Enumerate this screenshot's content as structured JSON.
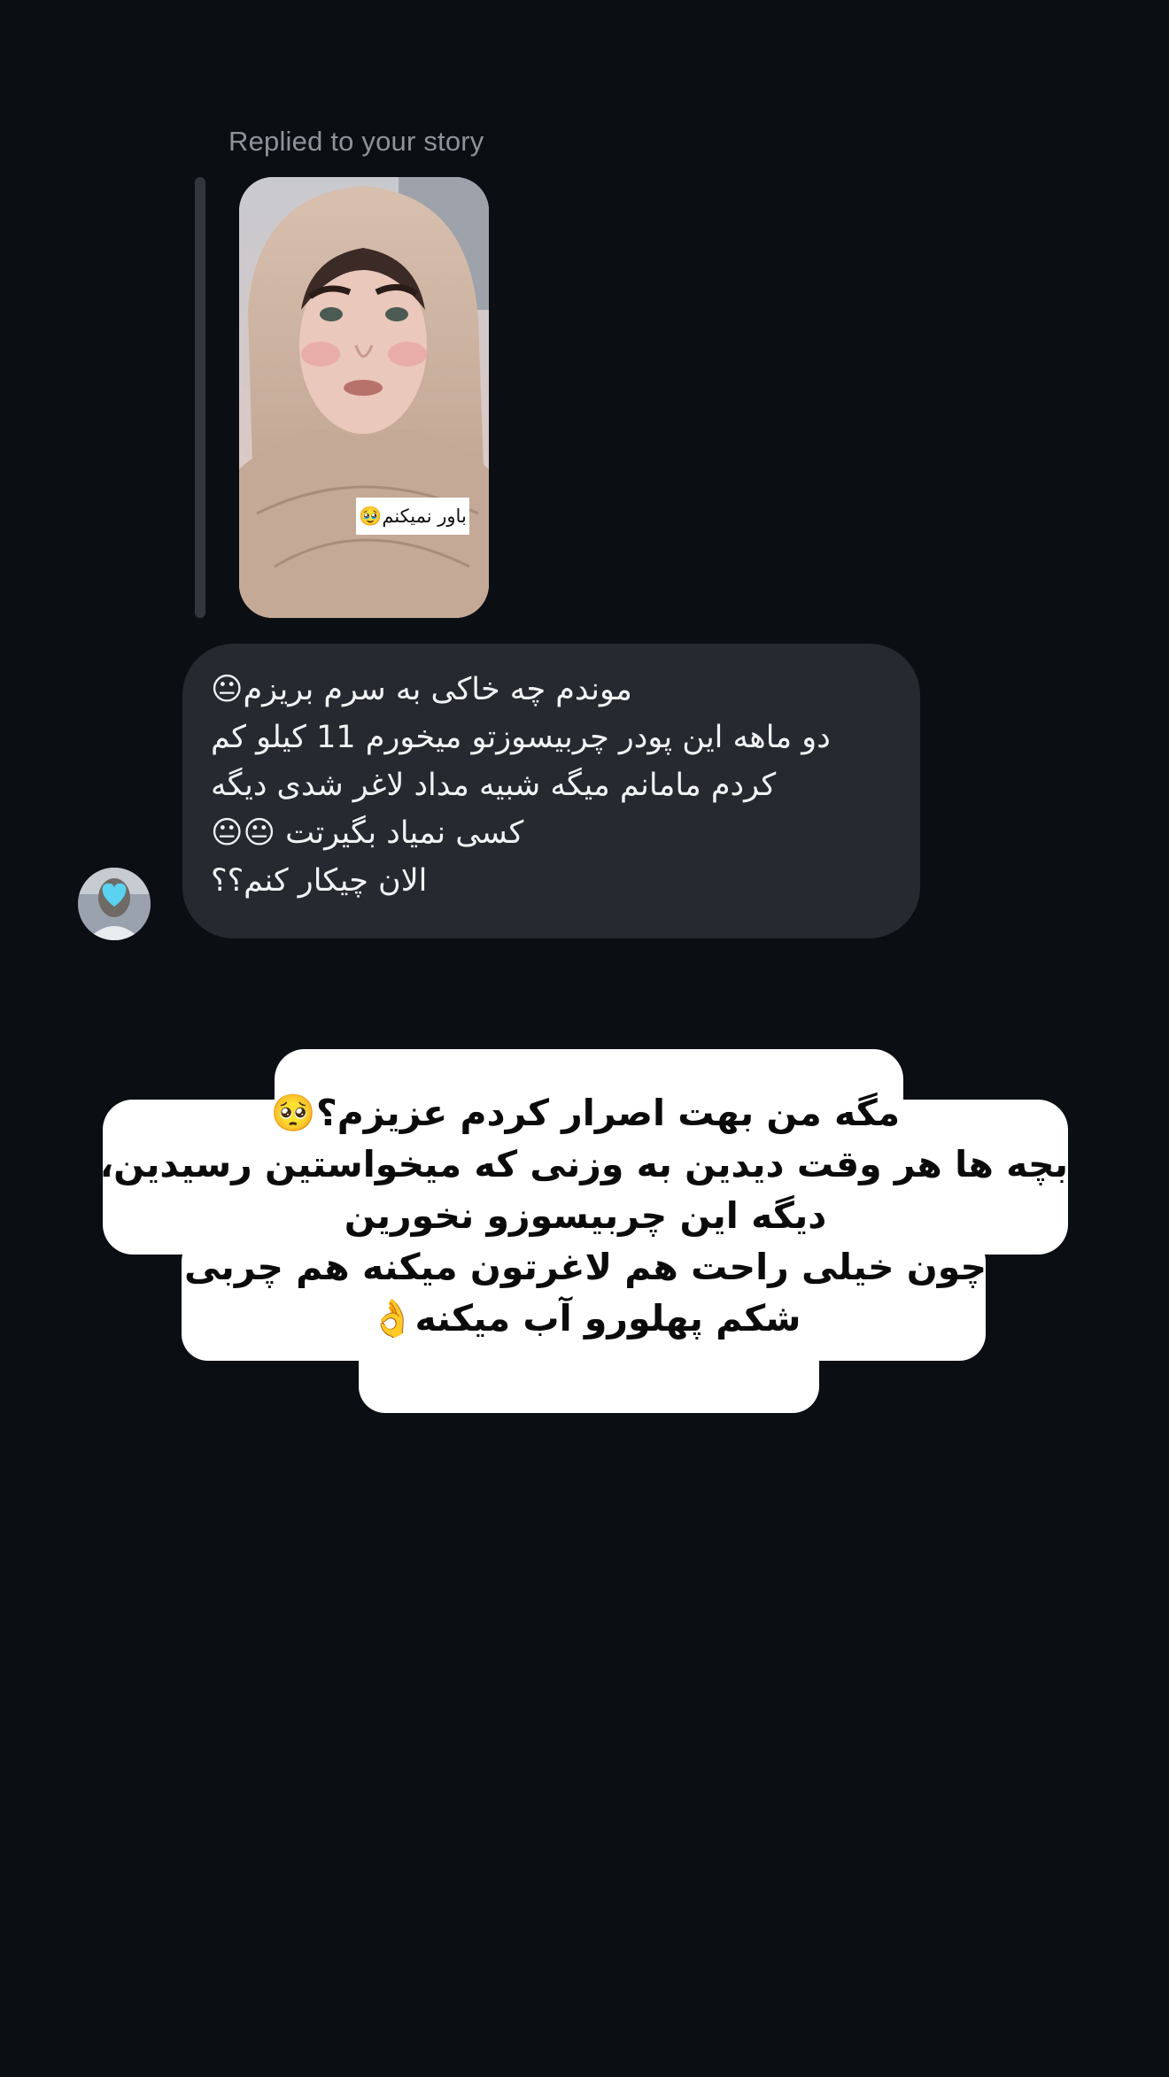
{
  "reply": {
    "label": "Replied to your story",
    "story_sticker": "باور نمیکنم🥹"
  },
  "message": {
    "lines": [
      "موندم چه خاکی به سرم بریزم😐",
      "دو ماهه این پودر چربیسوزتو میخورم 11 کیلو کم",
      "کردم مامانم میگه شبیه مداد لاغر شدی دیگه",
      "کسی نمیاد بگیرتت 😐😐",
      "الان چیکار کنم؟؟"
    ]
  },
  "overlay": {
    "lines": [
      "مگه من بهت اصرار کردم عزیزم؟🥺",
      "بچه ها هر وقت دیدین به وزنی که میخواستین رسیدین،",
      "دیگه این چربیسوزو نخورین",
      "چون خیلی راحت هم لاغرتون میکنه هم چربی",
      "شکم پهلورو آب میکنه👌"
    ]
  },
  "colors": {
    "background": "#0b0e13",
    "bubble": "#26292f",
    "overlay_box": "#ffffff",
    "muted_text": "#8e939a"
  },
  "icons": {
    "avatar": "heart-avatar-icon"
  }
}
